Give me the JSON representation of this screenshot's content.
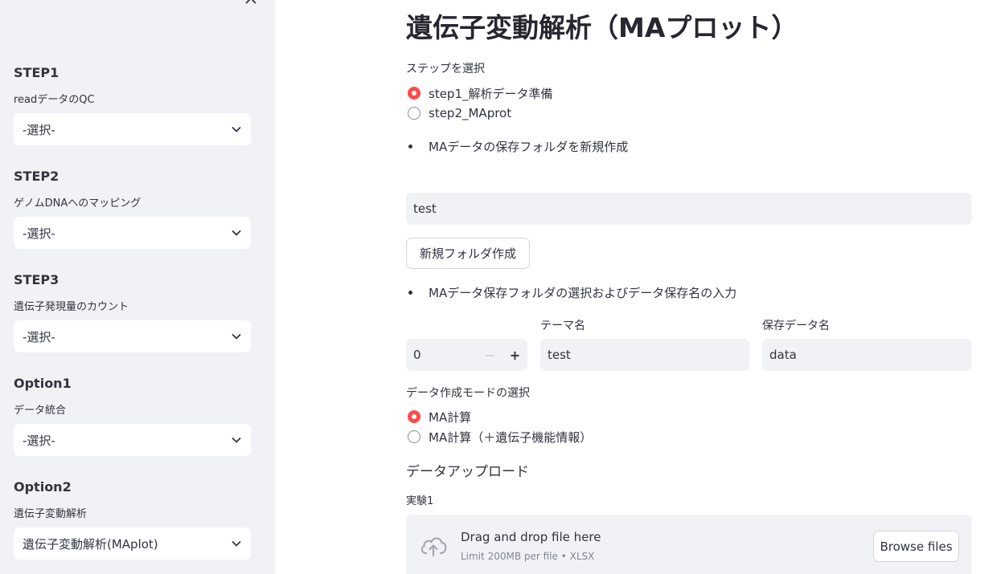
{
  "sidebar": {
    "sections": [
      {
        "heading": "STEP1",
        "label": "readデータのQC",
        "value": "-選択-"
      },
      {
        "heading": "STEP2",
        "label": "ゲノムDNAへのマッピング",
        "value": "-選択-"
      },
      {
        "heading": "STEP3",
        "label": "遺伝子発現量のカウント",
        "value": "-選択-"
      },
      {
        "heading": "Option1",
        "label": "データ統合",
        "value": "-選択-"
      },
      {
        "heading": "Option2",
        "label": "遺伝子変動解析",
        "value": "遺伝子変動解析(MAplot)"
      }
    ]
  },
  "main": {
    "title": "遺伝子変動解析（MAプロット）",
    "step_label": "ステップを選択",
    "step_options": [
      "step1_解析データ準備",
      "step2_MAprot"
    ],
    "step_selected": 0,
    "bullet1": "MAデータの保存フォルダを新規作成",
    "folder_input_value": "test",
    "new_folder_button": "新規フォルダ作成",
    "bullet2": "MAデータ保存フォルダの選択およびデータ保存名の入力",
    "number_value": "0",
    "minus_label": "−",
    "plus_label": "+",
    "theme_label": "テーマ名",
    "theme_value": "test",
    "save_label": "保存データ名",
    "save_value": "data",
    "mode_label": "データ作成モードの選択",
    "mode_options": [
      "MA計算",
      "MA計算（＋遺伝子機能情報）"
    ],
    "mode_selected": 0,
    "upload_heading": "データアップロード",
    "experiment_label": "実験1",
    "dropzone_title": "Drag and drop file here",
    "dropzone_sub": "Limit 200MB per file • XLSX",
    "browse_button": "Browse files"
  },
  "colors": {
    "accent": "#ff4b4b",
    "sidebar_bg": "#f0f2f6",
    "input_bg": "#f0f2f6"
  }
}
